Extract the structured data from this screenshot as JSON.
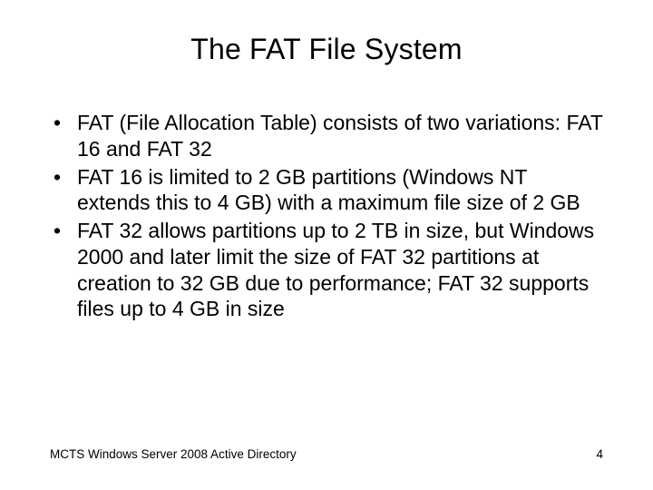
{
  "title": "The FAT File System",
  "bullets": [
    "FAT (File Allocation Table) consists of two variations: FAT 16 and FAT 32",
    "FAT 16 is limited to 2 GB partitions (Windows NT extends this to 4 GB) with a maximum file size of 2 GB",
    "FAT 32 allows partitions up to 2 TB in size, but Windows 2000 and later limit the size of FAT 32 partitions at creation to 32 GB due to performance; FAT 32 supports files up to 4 GB in size"
  ],
  "footer": {
    "left": "MCTS Windows Server 2008 Active Directory",
    "right": "4"
  }
}
